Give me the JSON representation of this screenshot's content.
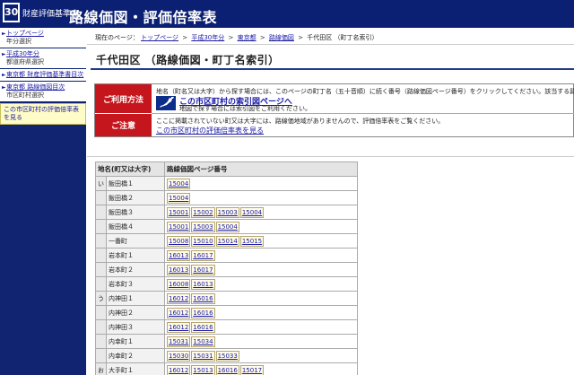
{
  "header": {
    "logo_number": "30",
    "logo_sub": "財産評価基準書",
    "title": "路線価図・評価倍率表"
  },
  "sidebar": {
    "items": [
      {
        "label": "トップページ",
        "sub": "年分選択"
      },
      {
        "label": "平成30年分",
        "sub": "都道府県選択"
      },
      {
        "label": "東京都 財産評価基準書目次",
        "sub": ""
      },
      {
        "label": "東京都 路線価図目次",
        "sub": "市区町村選択"
      }
    ],
    "highlight": "この市区町村の評価倍率表を見る"
  },
  "breadcrumb": {
    "prefix": "現在のページ：",
    "items": [
      "トップページ",
      "平成30年分",
      "東京都",
      "路線価図"
    ],
    "current": "千代田区 （町丁名索引）",
    "separator": ">"
  },
  "page_title": "千代田区 （路線価図・町丁名索引）",
  "usage": {
    "label": "ご利用方法",
    "text": "地名（町名又は大字）から探す場合には、このページの町丁名（五十音順）に続く番号（路線価図ページ番号）をクリックしてください。該当する路線価図",
    "link": "この市区町村の索引図ページへ",
    "sub": "地図で探す場合には索引図をご利用ください。"
  },
  "caution": {
    "label": "ご注意",
    "text": "ここに掲載されていない町又は大字には、路線価地域がありませんので、評価倍率表をご覧ください。",
    "link": "この市区町村の評価倍率表を見る"
  },
  "table": {
    "headers": [
      "地名(町又は大字)",
      "路線価図ページ番号"
    ],
    "rows": [
      {
        "kana": "い",
        "name": "飯田橋１",
        "pages": [
          "15004"
        ]
      },
      {
        "kana": "",
        "name": "飯田橋２",
        "pages": [
          "15004"
        ]
      },
      {
        "kana": "",
        "name": "飯田橋３",
        "pages": [
          "15001",
          "15002",
          "15003",
          "15004"
        ]
      },
      {
        "kana": "",
        "name": "飯田橋４",
        "pages": [
          "15001",
          "15003",
          "15004"
        ]
      },
      {
        "kana": "",
        "name": "一番町",
        "pages": [
          "15008",
          "15010",
          "15014",
          "15015"
        ]
      },
      {
        "kana": "",
        "name": "岩本町１",
        "pages": [
          "16013",
          "16017"
        ]
      },
      {
        "kana": "",
        "name": "岩本町２",
        "pages": [
          "16013",
          "16017"
        ]
      },
      {
        "kana": "",
        "name": "岩本町３",
        "pages": [
          "16008",
          "16013"
        ]
      },
      {
        "kana": "う",
        "name": "内神田１",
        "pages": [
          "16012",
          "16016"
        ]
      },
      {
        "kana": "",
        "name": "内神田２",
        "pages": [
          "16012",
          "16016"
        ]
      },
      {
        "kana": "",
        "name": "内神田３",
        "pages": [
          "16012",
          "16016"
        ]
      },
      {
        "kana": "",
        "name": "内幸町１",
        "pages": [
          "15031",
          "15034"
        ]
      },
      {
        "kana": "",
        "name": "内幸町２",
        "pages": [
          "15030",
          "15031",
          "15033"
        ]
      },
      {
        "kana": "お",
        "name": "大手町１",
        "pages": [
          "16012",
          "15013",
          "16016",
          "15017"
        ]
      }
    ]
  }
}
